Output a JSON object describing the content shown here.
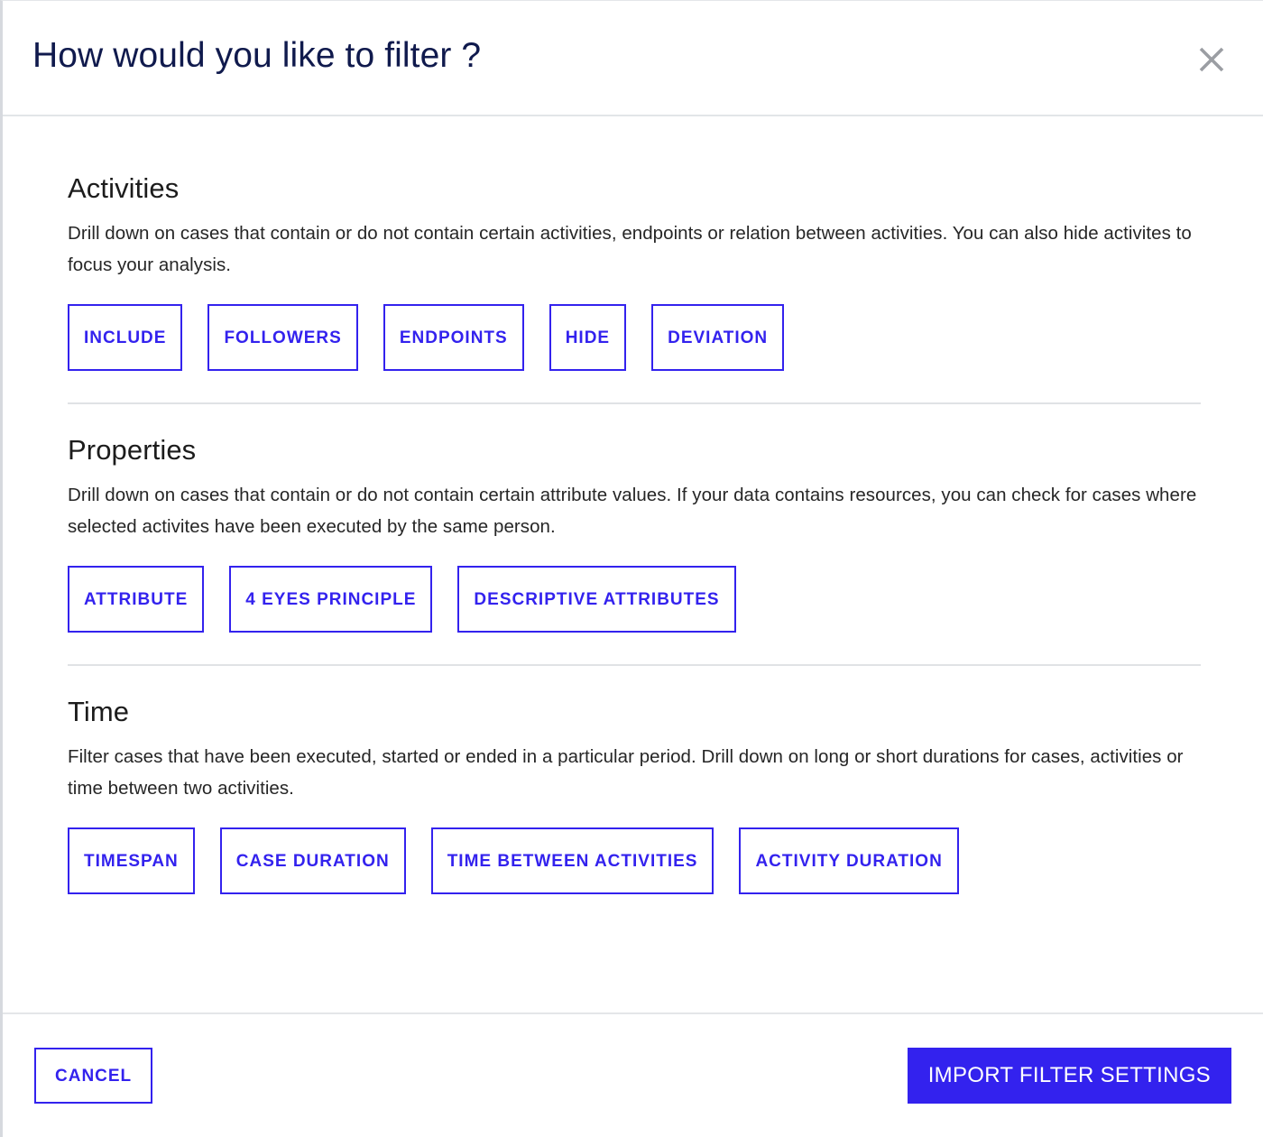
{
  "dialog": {
    "title": "How would you like to filter ?",
    "close_icon": "close-icon"
  },
  "sections": [
    {
      "id": "activities",
      "title": "Activities",
      "description": "Drill down on cases that contain or do not contain certain activities, endpoints or relation between activities. You can also hide activites to focus your analysis.",
      "buttons": [
        {
          "label": "INCLUDE"
        },
        {
          "label": "FOLLOWERS"
        },
        {
          "label": "ENDPOINTS"
        },
        {
          "label": "HIDE"
        },
        {
          "label": "DEVIATION"
        }
      ]
    },
    {
      "id": "properties",
      "title": "Properties",
      "description": "Drill down on cases that contain or do not contain certain attribute values. If your data contains resources, you can check for cases where selected activites have been executed by the same person.",
      "buttons": [
        {
          "label": "ATTRIBUTE"
        },
        {
          "label": "4 EYES PRINCIPLE"
        },
        {
          "label": "DESCRIPTIVE ATTRIBUTES"
        }
      ]
    },
    {
      "id": "time",
      "title": "Time",
      "description": "Filter cases that have been executed, started or ended in a particular period. Drill down on long or short durations for cases, activities or time between two activities.",
      "buttons": [
        {
          "label": "TIMESPAN"
        },
        {
          "label": "CASE DURATION"
        },
        {
          "label": "TIME BETWEEN ACTIVITIES"
        },
        {
          "label": "ACTIVITY DURATION"
        }
      ]
    }
  ],
  "footer": {
    "cancel_label": "CANCEL",
    "import_label": "IMPORT FILTER SETTINGS"
  },
  "colors": {
    "accent": "#3322ee",
    "title": "#101a4d",
    "heading": "#1c1c1c",
    "body_text": "#262626",
    "divider": "#e0e2e5",
    "close_icon": "#9b9ea3"
  }
}
